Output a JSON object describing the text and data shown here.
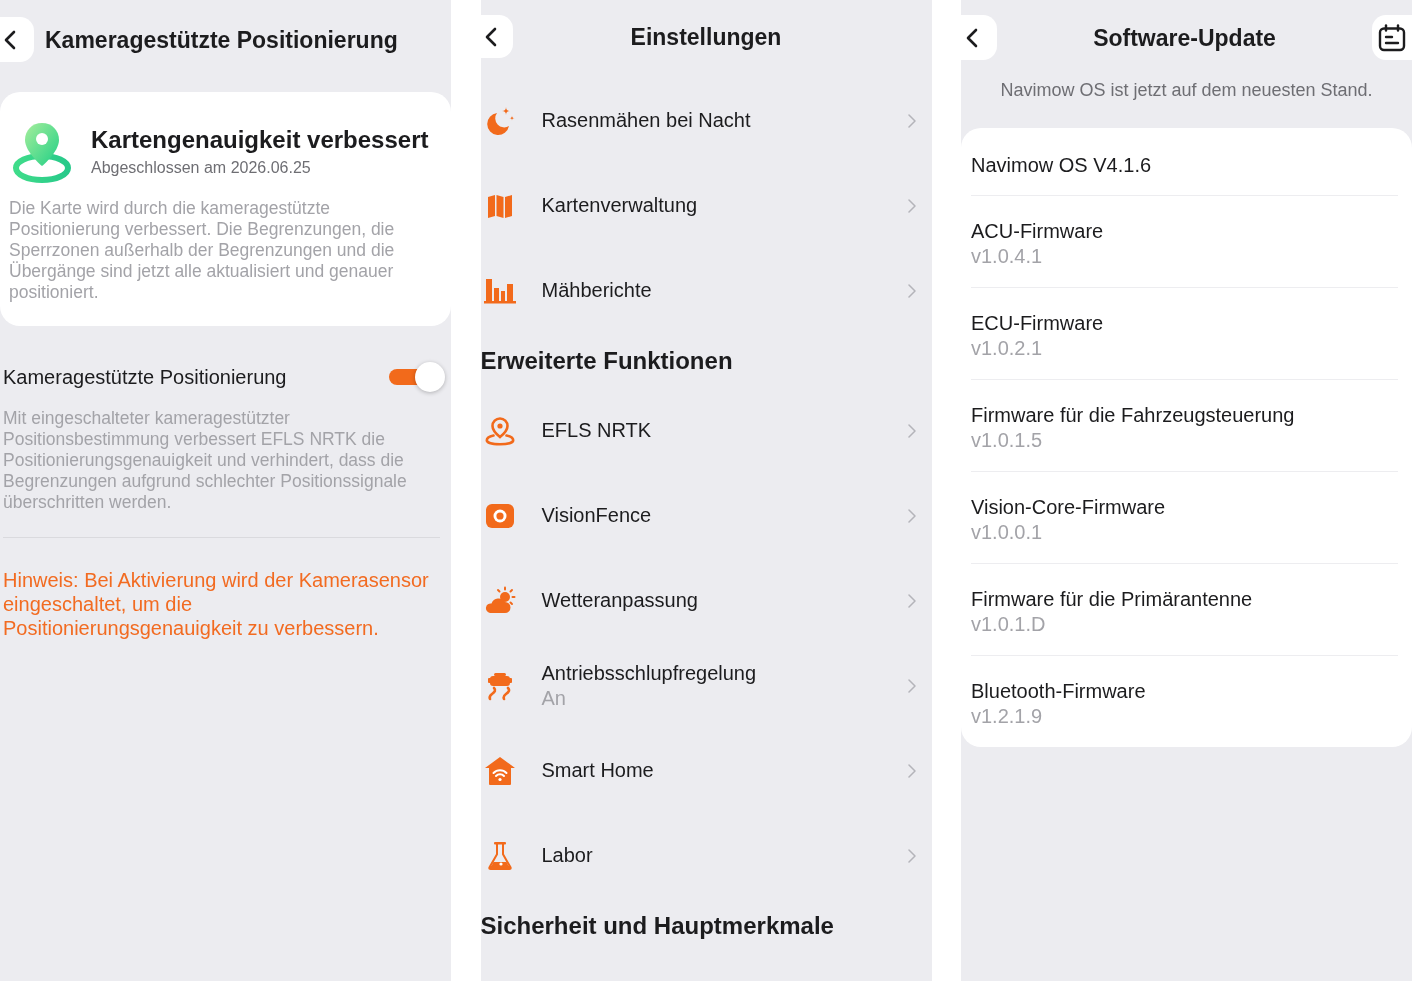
{
  "positioning_screen": {
    "title": "Kameragestützte Positionierung",
    "result_card": {
      "title": "Kartengenauigkeit verbessert",
      "subtitle": "Abgeschlossen am 2026.06.25",
      "description": "Die Karte wird durch die kameragestützte Positionierung verbessert. Die Begrenzungen, die Sperrzonen außerhalb der Begrenzungen und die Übergänge sind jetzt alle aktualisiert und genauer positioniert."
    },
    "toggle": {
      "label": "Kameragestützte Positionierung",
      "on": true,
      "description": "Mit eingeschalteter kameragestützter Positionsbestimmung verbessert EFLS NRTK die Positionierungsgenauigkeit und verhindert, dass die Begrenzungen aufgrund schlechter Positionssignale überschritten werden."
    },
    "hint": "Hinweis: Bei Aktivierung wird der Kamerasensor eingeschaltet, um die Positionierungsgenauigkeit zu verbessern."
  },
  "settings_screen": {
    "title": "Einstellungen",
    "groups": [
      {
        "items": [
          {
            "label": "Rasenmähen bei Nacht"
          },
          {
            "label": "Kartenverwaltung"
          },
          {
            "label": "Mähberichte"
          }
        ]
      },
      {
        "heading": "Erweiterte Funktionen",
        "items": [
          {
            "label": "EFLS NRTK"
          },
          {
            "label": "VisionFence"
          },
          {
            "label": "Wetteranpassung"
          },
          {
            "label": "Antriebsschlupfregelung",
            "value": "An"
          },
          {
            "label": "Smart Home"
          },
          {
            "label": "Labor"
          }
        ]
      },
      {
        "heading": "Sicherheit und Hauptmerkmale"
      }
    ]
  },
  "update_screen": {
    "title": "Software-Update",
    "subtitle": "Navimow OS ist jetzt auf dem neuesten Stand.",
    "os_version": "Navimow OS V4.1.6",
    "firmware": [
      {
        "name": "ACU-Firmware",
        "version": "v1.0.4.1"
      },
      {
        "name": "ECU-Firmware",
        "version": "v1.0.2.1"
      },
      {
        "name": "Firmware für die Fahrzeugsteuerung",
        "version": "v1.0.1.5"
      },
      {
        "name": "Vision-Core-Firmware",
        "version": "v1.0.0.1"
      },
      {
        "name": "Firmware für die Primärantenne",
        "version": "v1.0.1.D"
      },
      {
        "name": "Bluetooth-Firmware",
        "version": "v1.2.1.9"
      }
    ]
  }
}
